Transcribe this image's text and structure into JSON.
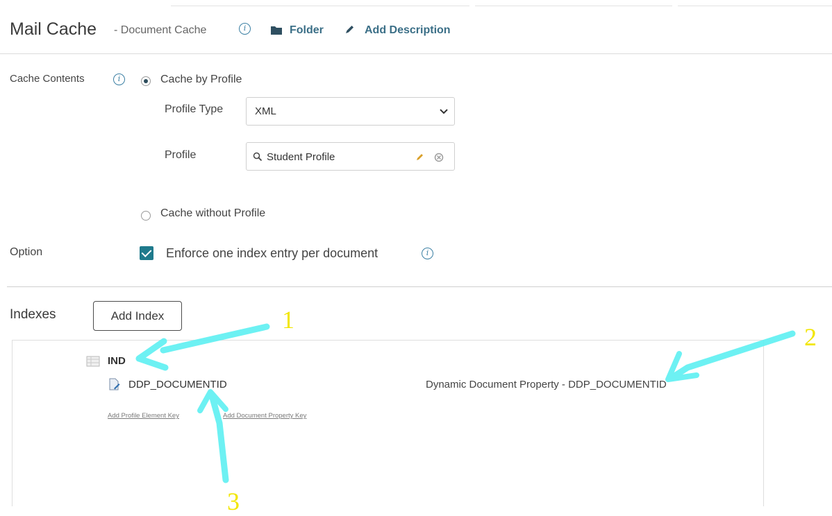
{
  "header": {
    "title": "Mail Cache",
    "subtitle": "- Document Cache",
    "folder_link": "Folder",
    "description_link": "Add Description"
  },
  "cache_contents": {
    "label": "Cache Contents",
    "by_profile_label": "Cache by Profile",
    "by_profile_selected": true,
    "profile_type_label": "Profile Type",
    "profile_type_value": "XML",
    "profile_label": "Profile",
    "profile_value": "Student Profile",
    "without_profile_label": "Cache without Profile",
    "without_profile_selected": false
  },
  "option": {
    "label": "Option",
    "enforce_label": "Enforce one index entry per document",
    "enforce_checked": true
  },
  "indexes": {
    "label": "Indexes",
    "add_button": "Add Index",
    "tree": {
      "index_name": "IND",
      "key_name": "DDP_DOCUMENTID",
      "key_description": "Dynamic Document Property - DDP_DOCUMENTID",
      "add_profile_element_key": "Add Profile Element Key",
      "add_document_property_key": "Add Document Property Key"
    }
  },
  "annotations": {
    "label_1": "1",
    "label_2": "2",
    "label_3": "3",
    "arrow_color": "#5ef0f2",
    "number_color": "#f2e600"
  },
  "colors": {
    "accent": "#1f7a8c",
    "link": "#3b6f87",
    "info_icon": "#3a7fa3"
  }
}
